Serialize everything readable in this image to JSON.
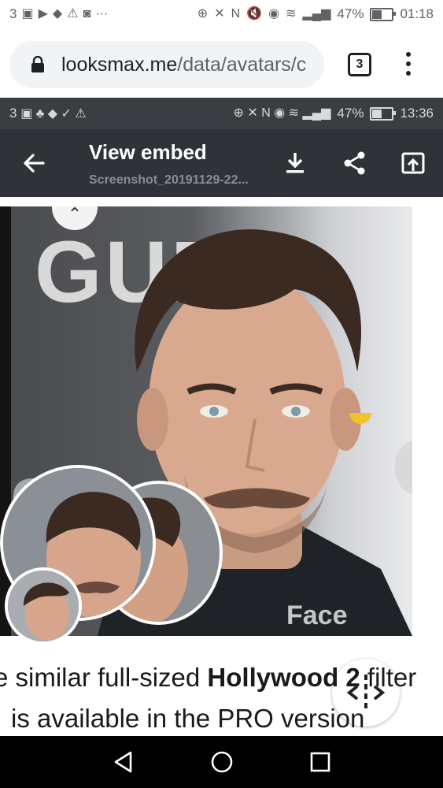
{
  "status_bar": {
    "left_text": "3",
    "battery": "47%",
    "time": "01:18"
  },
  "browser": {
    "url_host": "looksmax.me",
    "url_path": "/data/avatars/c",
    "tab_count": "3"
  },
  "embedded": {
    "status": {
      "left_text": "3",
      "battery": "47%",
      "time": "13:36"
    },
    "title": "View embed",
    "subtitle": "Screenshot_20191129-22...",
    "watermark": "Face",
    "caption": {
      "line1_pre": "e similar full-sized ",
      "line1_bold": "Hollywood 2",
      "line1_post": " filter",
      "line2": "is available in the PRO version"
    }
  },
  "icons": {
    "lock": "lock-icon",
    "menu": "more-vert-icon",
    "back": "arrow-back-icon",
    "download": "download-icon",
    "share": "share-icon",
    "open": "open-in-app-icon",
    "compare": "compare-arrows-icon",
    "nav_back": "nav-back-icon",
    "nav_home": "nav-home-icon",
    "nav_recents": "nav-recents-icon"
  },
  "colors": {
    "url_pill_bg": "#f1f3f4",
    "embed_toolbar_bg": "#2f3237",
    "nav_bar_bg": "#000000"
  }
}
